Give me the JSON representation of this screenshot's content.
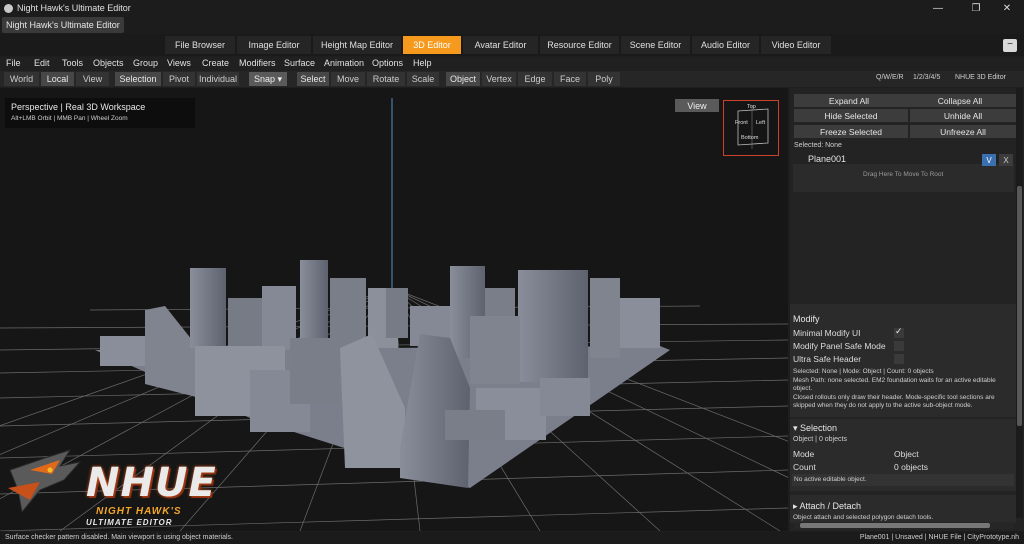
{
  "window": {
    "title": "Night Hawk's Ultimate Editor",
    "document_tab": "Night Hawk's Ultimate Editor",
    "minimize": "—",
    "maximize": "❐",
    "close": "✕"
  },
  "editor_tabs": [
    "File Browser",
    "Image Editor",
    "Height Map Editor",
    "3D Editor",
    "Avatar Editor",
    "Resource Editor",
    "Scene Editor",
    "Audio Editor",
    "Video Editor"
  ],
  "active_editor_tab": "3D Editor",
  "collapse_button": "−",
  "menus": [
    "File",
    "Edit",
    "Tools",
    "Objects",
    "Group",
    "Views",
    "Create",
    "Modifiers",
    "Surface",
    "Animation",
    "Options",
    "Help"
  ],
  "toolbar": {
    "space": [
      "World",
      "Local",
      "View"
    ],
    "pivot": [
      "Selection",
      "Pivot",
      "Individual"
    ],
    "snap": "Snap ▾",
    "transform": [
      "Select",
      "Move",
      "Rotate",
      "Scale"
    ],
    "subobject": [
      "Object",
      "Vertex",
      "Edge",
      "Face",
      "Poly"
    ],
    "shortcuts": "Q/W/E/R",
    "modes": "1/2/3/4/5",
    "editor_name": "NHUE 3D Editor"
  },
  "viewport": {
    "title": "Perspective | Real 3D Workspace",
    "hint": "Alt+LMB Orbit | MMB Pan | Wheel Zoom",
    "view_button": "View",
    "cube": {
      "top": "Top",
      "front": "Front",
      "left": "Left",
      "bottom": "Bottom"
    },
    "brand": {
      "main": "NHUE",
      "sub": "NIGHT HAWK'S",
      "sub2": "ULTIMATE EDITOR"
    }
  },
  "panel": {
    "expand_all": "Expand All",
    "collapse_all": "Collapse All",
    "hide_selected": "Hide Selected",
    "unhide_all": "Unhide All",
    "freeze_selected": "Freeze Selected",
    "unfreeze_all": "Unfreeze All",
    "selected_label": "Selected: None",
    "object_name": "Plane001",
    "visible_toggle": "V",
    "remove_toggle": "X",
    "drop_hint": "Drag Here To Move To Root",
    "modify": {
      "title": "Modify",
      "options": [
        {
          "label": "Minimal Modify UI",
          "checked": true
        },
        {
          "label": "Modify Panel Safe Mode",
          "checked": false
        },
        {
          "label": "Ultra Safe Header",
          "checked": false
        }
      ],
      "info1": "Selected: None | Mode: Object | Count: 0 objects",
      "info2a": "Mesh Path: none selected. EM2 foundation waits for an active editable",
      "info2b": "object.",
      "info3a": "Closed rollouts only draw their header. Mode-specific tool sections are",
      "info3b": "skipped when they do not apply to the active sub-object mode."
    },
    "selection": {
      "title": "▾ Selection",
      "summary": "Object | 0 objects",
      "mode_label": "Mode",
      "mode_value": "Object",
      "count_label": "Count",
      "count_value": "0 objects",
      "note": "No active editable object."
    },
    "attach": {
      "title": "▸ Attach / Detach",
      "desc": "Object attach and selected polygon detach tools."
    }
  },
  "status": {
    "left": "Surface checker pattern disabled. Main viewport is using object materials.",
    "right": "Plane001 | Unsaved | NHUE File | CityPrototype.nh"
  }
}
